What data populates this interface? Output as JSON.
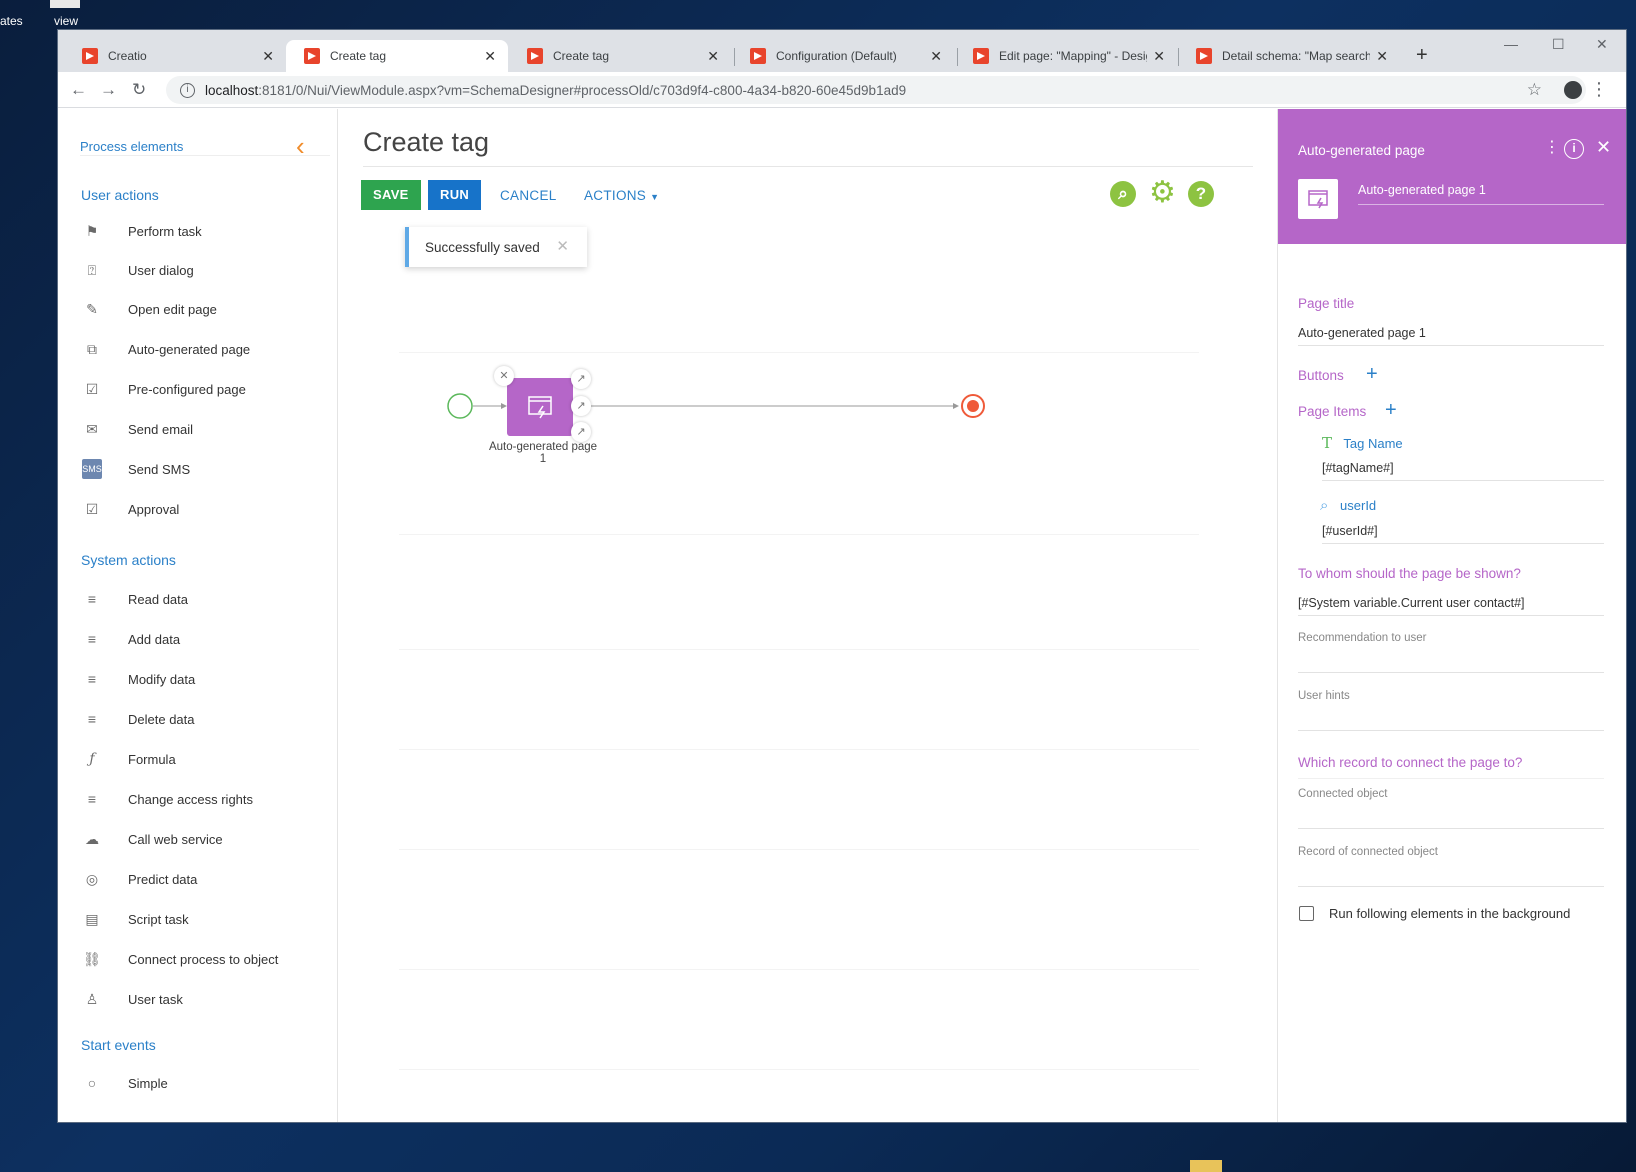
{
  "desktop": {
    "label_left": "ates",
    "label_view": "view"
  },
  "tabs": [
    {
      "title": "Creatio",
      "active": false
    },
    {
      "title": "Create tag",
      "active": true
    },
    {
      "title": "Create tag",
      "active": false
    },
    {
      "title": "Configuration (Default)",
      "active": false
    },
    {
      "title": "Edit page: \"Mapping\" - Design",
      "active": false
    },
    {
      "title": "Detail schema: \"Map search a",
      "active": false
    }
  ],
  "address": {
    "host": "localhost",
    "path": ":8181/0/Nui/ViewModule.aspx?vm=SchemaDesigner#processOld/c703d9f4-c800-4a34-b820-60e45d9b1ad9"
  },
  "left_panel": {
    "header": "Process elements",
    "groups": {
      "user_actions": "User actions",
      "system_actions": "System actions",
      "start_events": "Start events"
    },
    "user_items": [
      "Perform task",
      "User dialog",
      "Open edit page",
      "Auto-generated page",
      "Pre-configured page",
      "Send email",
      "Send SMS",
      "Approval"
    ],
    "system_items": [
      "Read data",
      "Add data",
      "Modify data",
      "Delete data",
      "Formula",
      "Change access rights",
      "Call web service",
      "Predict data",
      "Script task",
      "Connect process to object",
      "User task"
    ],
    "start_items": [
      "Simple"
    ],
    "sms_icon_text": "SMS"
  },
  "main": {
    "title": "Create tag",
    "save": "SAVE",
    "run": "RUN",
    "cancel": "CANCEL",
    "actions": "ACTIONS",
    "toast": "Successfully saved",
    "node_label_line1": "Auto-generated page",
    "node_label_line2": "1"
  },
  "right_panel": {
    "header_title": "Auto-generated page",
    "element_name": "Auto-generated page 1",
    "page_title_label": "Page title",
    "page_title_value": "Auto-generated page 1",
    "buttons_label": "Buttons",
    "page_items_label": "Page Items",
    "items": [
      {
        "name": "Tag Name",
        "value": "[#tagName#]",
        "icon": "text-icon"
      },
      {
        "name": "userId",
        "value": "[#userId#]",
        "icon": "lookup-icon"
      }
    ],
    "whom_label": "To whom should the page be shown?",
    "whom_value": "[#System variable.Current user contact#]",
    "recommendation_label": "Recommendation to user",
    "hints_label": "User hints",
    "record_label": "Which record to connect the page to?",
    "connected_object_label": "Connected object",
    "record_of_connected_label": "Record of connected object",
    "run_background_label": "Run following elements in the background"
  },
  "colors": {
    "accent_purple": "#b566c8",
    "link_blue": "#2b80c8",
    "save_green": "#2ea44f",
    "run_blue": "#1773c9",
    "orange": "#f08c2a",
    "icon_green": "#8dc341"
  }
}
